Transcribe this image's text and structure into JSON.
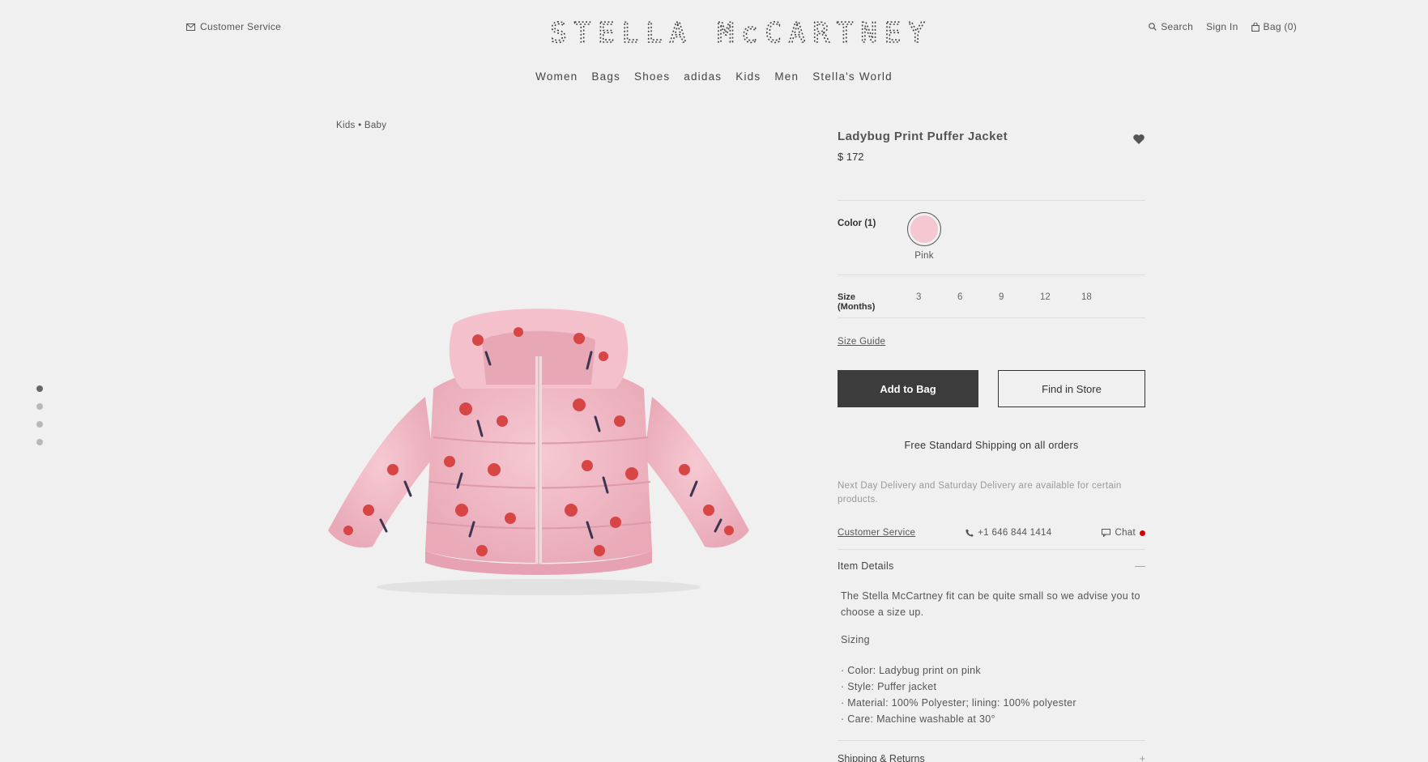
{
  "header": {
    "customer_service": "Customer Service",
    "brand": "STELLA McCARTNEY",
    "search": "Search",
    "sign_in": "Sign In",
    "bag": "Bag (0)"
  },
  "nav": {
    "items": [
      "Women",
      "Bags",
      "Shoes",
      "adidas",
      "Kids",
      "Men",
      "Stella's World"
    ]
  },
  "breadcrumb": "Kids • Baby",
  "carousel": {
    "count": 4,
    "active": 0
  },
  "product": {
    "title": "Ladybug Print Puffer Jacket",
    "price": "$ 172",
    "color_label": "Color (1)",
    "color_name": "Pink",
    "color_hex": "#f4c7d1",
    "size_label": "Size (Months)",
    "sizes": [
      "3",
      "6",
      "9",
      "12",
      "18"
    ],
    "size_guide": "Size Guide",
    "add_to_bag": "Add to Bag",
    "find_in_store": "Find in Store",
    "shipping": "Free Standard Shipping on all orders",
    "delivery_note": "Next Day Delivery and Saturday Delivery are available for certain products.",
    "customer_service": "Customer Service",
    "phone": "+1 646 844 1414",
    "chat": "Chat",
    "details_title": "Item Details",
    "details_toggle": "—",
    "fit_note": "The Stella McCartney fit can be quite small so we advise you to choose a size up.",
    "sizing": "Sizing",
    "features": [
      "· Color: Ladybug print on pink",
      "· Style: Puffer jacket",
      "· Material: 100% Polyester; lining: 100% polyester",
      "· Care: Machine washable at 30°"
    ],
    "shipping_returns": "Shipping & Returns",
    "shipping_toggle": "+"
  },
  "colors": {
    "accent_dark": "#3c3c3c",
    "chat_status": "#d40000",
    "background": "#f0f0f0"
  }
}
